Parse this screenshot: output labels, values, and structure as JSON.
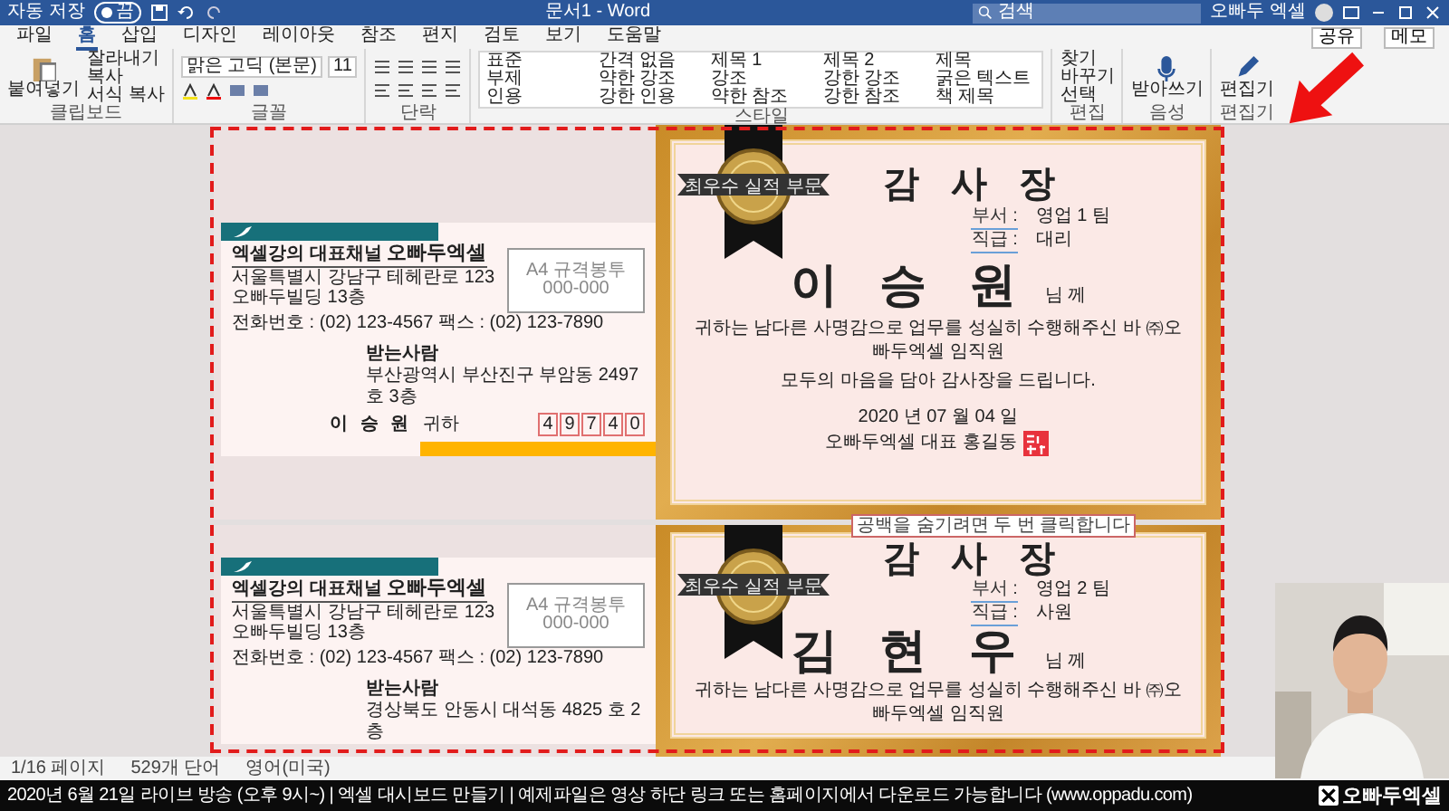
{
  "title_bar": {
    "autosave": {
      "label": "자동 저장",
      "on": false,
      "state_text": "끔"
    },
    "title": "문서1 - Word",
    "search": {
      "placeholder": "검색"
    },
    "user": "오빠두 엑셀"
  },
  "menu_tabs": [
    {
      "label": "파일",
      "selected": false
    },
    {
      "label": "홈",
      "selected": true
    },
    {
      "label": "삽입",
      "selected": false
    },
    {
      "label": "디자인",
      "selected": false
    },
    {
      "label": "레이아웃",
      "selected": false
    },
    {
      "label": "참조",
      "selected": false
    },
    {
      "label": "편지",
      "selected": false
    },
    {
      "label": "검토",
      "selected": false
    },
    {
      "label": "보기",
      "selected": false
    },
    {
      "label": "도움말",
      "selected": false
    }
  ],
  "share_buttons": [
    "공유",
    "메모"
  ],
  "ribbon": {
    "clipboard": {
      "paste": "붙여넣기",
      "actions": [
        "잘라내기",
        "복사",
        "서식 복사"
      ],
      "label": "클립보드"
    },
    "font": {
      "family": "맑은 고딕 (본문)",
      "size": "11",
      "label": "글꼴"
    },
    "paragraph": {
      "label": "단락"
    },
    "styles": {
      "items": [
        "표준",
        "간격 없음",
        "제목 1",
        "제목 2",
        "제목",
        "부제",
        "약한 강조",
        "강조",
        "강한 강조",
        "굵은 텍스트",
        "인용",
        "강한 인용",
        "약한 참조",
        "강한 참조",
        "책 제목"
      ],
      "label": "스타일"
    },
    "editing": {
      "actions": [
        "찾기",
        "바꾸기",
        "선택"
      ],
      "label": "편집"
    },
    "voice": {
      "button": "받아쓰기",
      "label": "음성"
    },
    "editor": {
      "button": "편집기",
      "label": "편집기"
    }
  },
  "pages": [
    {
      "envelope": {
        "tagline": "엑셀강의 대표채널",
        "sender": "오빠두엑셀",
        "address_lines": [
          "서울특별시 강남구 테헤란로 123",
          "오빠두빌딩 13층"
        ],
        "contact": "전화번호 : (02) 123-4567  팩스 : (02) 123-7890",
        "thumbnail": {
          "label": "A4 규격봉투",
          "code": "000-000"
        },
        "recipient_label": "받는사람",
        "recipient_address": "부산광역시 부산진구 부암동 2497 호 3층",
        "recipient_name": "이 승 원",
        "honorific": "귀하",
        "postal_digits": [
          "4",
          "9",
          "7",
          "4",
          "0"
        ]
      },
      "certificate": {
        "badge": "최우수 실적 부문",
        "title": "감 사 장",
        "fields": [
          {
            "label": "부서 :",
            "value": "영업 1 팀"
          },
          {
            "label": "직급 :",
            "value": "대리"
          }
        ],
        "name": "이 승 원",
        "name_suffix": "님 께",
        "body": [
          "귀하는 남다른 사명감으로 업무를 성실히 수행해주신 바 ㈜오빠두엑셀 임직원",
          "모두의 마음을 담아 감사장을 드립니다."
        ],
        "date": "2020 년 07 월 04 일",
        "signer": "오빠두엑셀 대표 홍길동"
      }
    },
    {
      "envelope": {
        "tagline": "엑셀강의 대표채널",
        "sender": "오빠두엑셀",
        "address_lines": [
          "서울특별시 강남구 테헤란로 123",
          "오빠두빌딩 13층"
        ],
        "contact": "전화번호 : (02) 123-4567  팩스 : (02) 123-7890",
        "thumbnail": {
          "label": "A4 규격봉투",
          "code": "000-000"
        },
        "recipient_label": "받는사람",
        "recipient_address": "경상북도 안동시 대석동 4825 호 2층"
      },
      "certificate": {
        "badge": "최우수 실적 부문",
        "title": "감 사 장",
        "fields": [
          {
            "label": "부서 :",
            "value": "영업 2 팀"
          },
          {
            "label": "직급 :",
            "value": "사원"
          }
        ],
        "name": "김 현 우",
        "name_suffix": "님 께",
        "body": [
          "귀하는 남다른 사명감으로 업무를 성실히 수행해주신 바 ㈜오빠두엑셀 임직원"
        ]
      }
    }
  ],
  "hint_tooltip": "공백을 숨기려면 두 번 클릭합니다",
  "status_bar": [
    "1/16 페이지",
    "529개 단어",
    "영어(미국)"
  ],
  "ticker": {
    "text": "2020년 6월 21일 라이브 방송 (오후 9시~) | 엑셀 대시보드 만들기 | 예제파일은 영상 하단 링크 또는 홈페이지에서 다운로드 가능합니다 (www.oppadu.com)",
    "logo": "오빠두엑셀"
  }
}
